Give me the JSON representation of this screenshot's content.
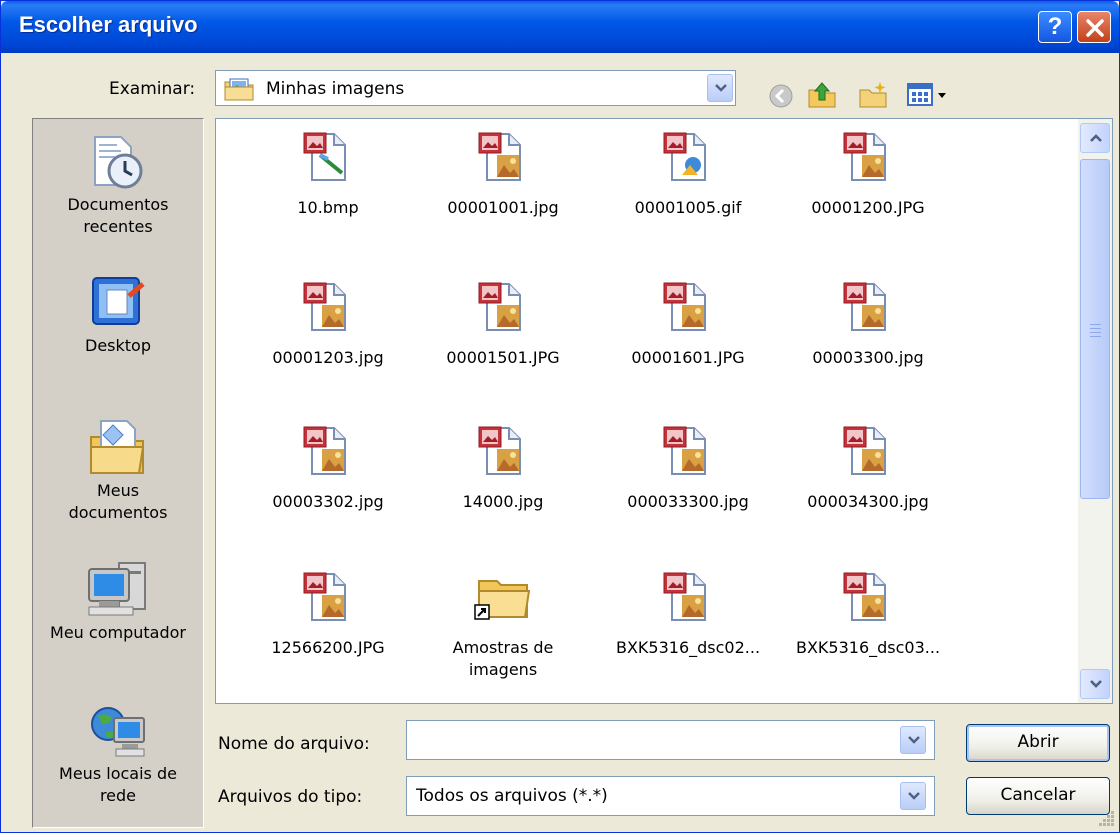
{
  "window": {
    "title": "Escolher arquivo",
    "help_glyph": "?"
  },
  "lookin": {
    "label": "Examinar:",
    "value": "Minhas imagens"
  },
  "toolbar": {
    "icons": [
      "back-icon",
      "up-folder-icon",
      "new-folder-icon",
      "view-menu-icon"
    ]
  },
  "places": [
    {
      "label": "Documentos recentes",
      "icon": "recent-documents-icon"
    },
    {
      "label": "Desktop",
      "icon": "desktop-icon"
    },
    {
      "label": "Meus documentos",
      "icon": "my-documents-icon"
    },
    {
      "label": "Meu computador",
      "icon": "my-computer-icon"
    },
    {
      "label": "Meus locais de rede",
      "icon": "network-places-icon"
    }
  ],
  "files": [
    {
      "name": "10.bmp",
      "icon": "bmp-file-icon"
    },
    {
      "name": "00001001.jpg",
      "icon": "jpg-file-icon"
    },
    {
      "name": "00001005.gif",
      "icon": "gif-file-icon"
    },
    {
      "name": "00001200.JPG",
      "icon": "jpg-file-icon"
    },
    {
      "name": "00001203.jpg",
      "icon": "jpg-file-icon"
    },
    {
      "name": "00001501.JPG",
      "icon": "jpg-file-icon"
    },
    {
      "name": "00001601.JPG",
      "icon": "jpg-file-icon"
    },
    {
      "name": "00003300.jpg",
      "icon": "jpg-file-icon"
    },
    {
      "name": "00003302.jpg",
      "icon": "jpg-file-icon"
    },
    {
      "name": "14000.jpg",
      "icon": "jpg-file-icon"
    },
    {
      "name": "000033300.jpg",
      "icon": "jpg-file-icon"
    },
    {
      "name": "000034300.jpg",
      "icon": "jpg-file-icon"
    },
    {
      "name": "12566200.JPG",
      "icon": "jpg-file-icon"
    },
    {
      "name": "Amostras de imagens",
      "icon": "folder-shortcut-icon"
    },
    {
      "name": "BXK5316_dsc02...",
      "icon": "jpg-file-icon"
    },
    {
      "name": "BXK5316_dsc03...",
      "icon": "jpg-file-icon"
    }
  ],
  "filename": {
    "label": "Nome do arquivo:",
    "value": ""
  },
  "filetype": {
    "label": "Arquivos do tipo:",
    "value": "Todos os arquivos (*.*)"
  },
  "buttons": {
    "open": "Abrir",
    "cancel": "Cancelar"
  },
  "colors": {
    "titlebar": "#0058E6",
    "dialog_bg": "#ECE9D8",
    "field_border": "#7F9DB9"
  }
}
